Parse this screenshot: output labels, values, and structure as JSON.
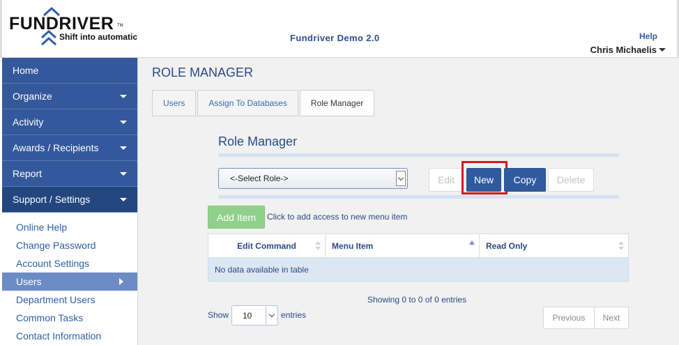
{
  "header": {
    "logo_text": "FUNDRIVER",
    "logo_tm": "TM",
    "logo_tagline": "Shift into automatic",
    "app_title": "Fundriver Demo 2.0",
    "help_label": "Help",
    "user_name": "Chris Michaelis"
  },
  "sidebar": {
    "items": [
      {
        "label": "Home",
        "has_dropdown": false
      },
      {
        "label": "Organize",
        "has_dropdown": true
      },
      {
        "label": "Activity",
        "has_dropdown": true
      },
      {
        "label": "Awards / Recipients",
        "has_dropdown": true
      },
      {
        "label": "Report",
        "has_dropdown": true
      },
      {
        "label": "Support / Settings",
        "has_dropdown": true,
        "active": true
      }
    ],
    "sub_items": [
      {
        "label": "Online Help"
      },
      {
        "label": "Change Password"
      },
      {
        "label": "Account Settings"
      },
      {
        "label": "Users",
        "selected": true
      },
      {
        "label": "Department Users"
      },
      {
        "label": "Common Tasks"
      },
      {
        "label": "Contact Information"
      }
    ]
  },
  "main": {
    "page_title": "ROLE MANAGER",
    "tabs": [
      {
        "label": "Users"
      },
      {
        "label": "Assign To Databases"
      },
      {
        "label": "Role Manager",
        "active": true
      }
    ],
    "panel_title": "Role Manager",
    "role_select_value": "<-Select Role->",
    "buttons": {
      "edit": "Edit",
      "new": "New",
      "copy": "Copy",
      "delete": "Delete",
      "add_item": "Add Item"
    },
    "add_item_hint": "Click to add access to new menu item",
    "table": {
      "columns": [
        "Edit Command",
        "Menu Item",
        "Read Only"
      ],
      "empty_message": "No data available in table"
    },
    "info_text": "Showing 0 to 0 of 0 entries",
    "show_label": "Show",
    "page_length": "10",
    "entries_label": "entries",
    "pager": {
      "previous": "Previous",
      "next": "Next"
    }
  },
  "colors": {
    "nav_bg": "#34589c",
    "nav_active_bg": "#23467f",
    "primary_button": "#305a9e",
    "add_button": "#8fd18a",
    "highlight_box": "#d6171f",
    "link": "#2d5fa3"
  }
}
